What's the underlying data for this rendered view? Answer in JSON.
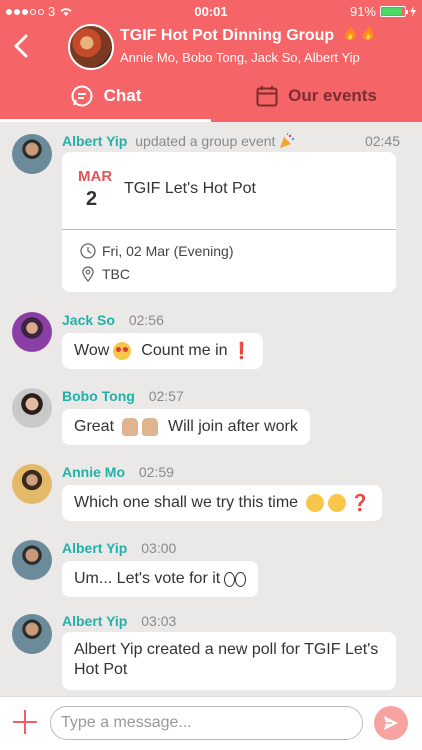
{
  "status_bar": {
    "carrier": "3",
    "time": "00:01",
    "battery": "91%",
    "battery_level": 0.91
  },
  "header": {
    "title": "TGIF Hot Pot Dinning Group",
    "title_icons": [
      "fire-icon",
      "fire-icon"
    ],
    "members": "Annie Mo, Bobo Tong, Jack So, Albert Yip",
    "back_icon": "chevron-left-icon"
  },
  "tabs": [
    {
      "label": "Chat",
      "icon": "chat-icon",
      "active": true
    },
    {
      "label": "Our events",
      "icon": "calendar-icon",
      "active": false
    }
  ],
  "messages": [
    {
      "sender": "Albert Yip",
      "action": "updated a group event",
      "time": "02:45",
      "event": {
        "month": "MAR",
        "day": "2",
        "title": "TGIF Let's Hot Pot",
        "date": "Fri, 02 Mar (Evening)",
        "location": "TBC"
      }
    },
    {
      "sender": "Jack So",
      "time": "02:56",
      "text_a": "Wow",
      "text_b": "Count me in",
      "text_c": "❗"
    },
    {
      "sender": "Bobo Tong",
      "time": "02:57",
      "text_a": "Great",
      "text_b": "Will join after work"
    },
    {
      "sender": "Annie Mo",
      "time": "02:59",
      "text_a": "Which one shall we try this time",
      "text_b": "❓"
    },
    {
      "sender": "Albert Yip",
      "time": "03:00",
      "text_a": "Um... Let's vote for it"
    },
    {
      "sender": "Albert Yip",
      "time": "03:03",
      "text_a": "Albert Yip created a new poll for TGIF Let's",
      "text_b": "Hot Pot"
    }
  ],
  "input": {
    "placeholder": "Type a message..."
  },
  "colors": {
    "header": "#f56467",
    "sender_name": "#22b1a6",
    "inactive_tab": "#7d2d2e"
  }
}
